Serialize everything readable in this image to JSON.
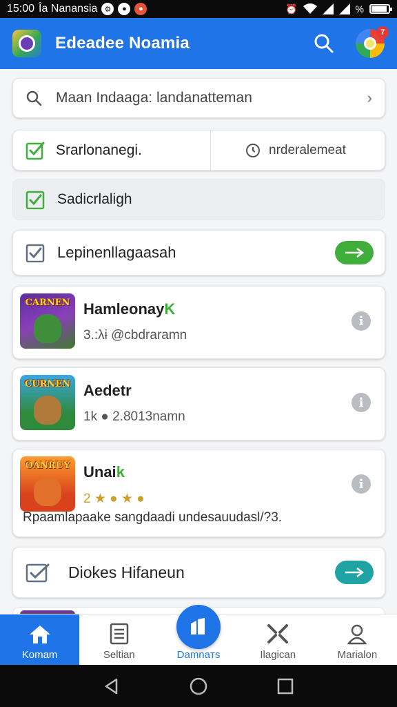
{
  "status_bar": {
    "time": "15:00",
    "carrier": "Îa Nanansia",
    "icons": [
      "settings-icon",
      "power-icon",
      "record-icon"
    ],
    "right_icons": [
      "alarm-icon",
      "wifi-icon",
      "signal-icon",
      "signal-icon"
    ],
    "battery_percent_symbol": "%"
  },
  "app_bar": {
    "title": "Edeadee Noamia",
    "notification_count": "7",
    "brand_color": "#1f74e8"
  },
  "search": {
    "text": "Maan Indaaga: landanatteman"
  },
  "split_row": {
    "left_label": "Srarlonanegi.",
    "right_label": "nrderalemeat"
  },
  "gray_row": {
    "label": "Sadicrlaligh"
  },
  "check_row": {
    "label": "Lepinenllagaasah"
  },
  "games": [
    {
      "thumb_label": "CARNEN",
      "title": "Hamleonay",
      "title_suffix": "K",
      "meta": "3.:λɨ  @cbdraramn"
    },
    {
      "thumb_label": "CURNEN",
      "title": "Aedetr",
      "title_suffix": "",
      "meta": "1k ● 2.8013namn"
    },
    {
      "thumb_label": "OANRUY",
      "title": "Unai",
      "title_suffix": "k",
      "meta": "2 ★ ● ★ ●",
      "description": "Rpaamlapaake sangdaadi undesauudasl/?3."
    }
  ],
  "action_row": {
    "label": "Diokes Hifaneun"
  },
  "bottom_nav": {
    "items": [
      {
        "label": "Komam",
        "icon": "home-icon"
      },
      {
        "label": "Seltian",
        "icon": "document-icon"
      },
      {
        "label": "Damnaтs",
        "icon": "grid-icon"
      },
      {
        "label": "Ilagican",
        "icon": "tools-icon"
      },
      {
        "label": "Marialon",
        "icon": "profile-icon"
      }
    ]
  }
}
